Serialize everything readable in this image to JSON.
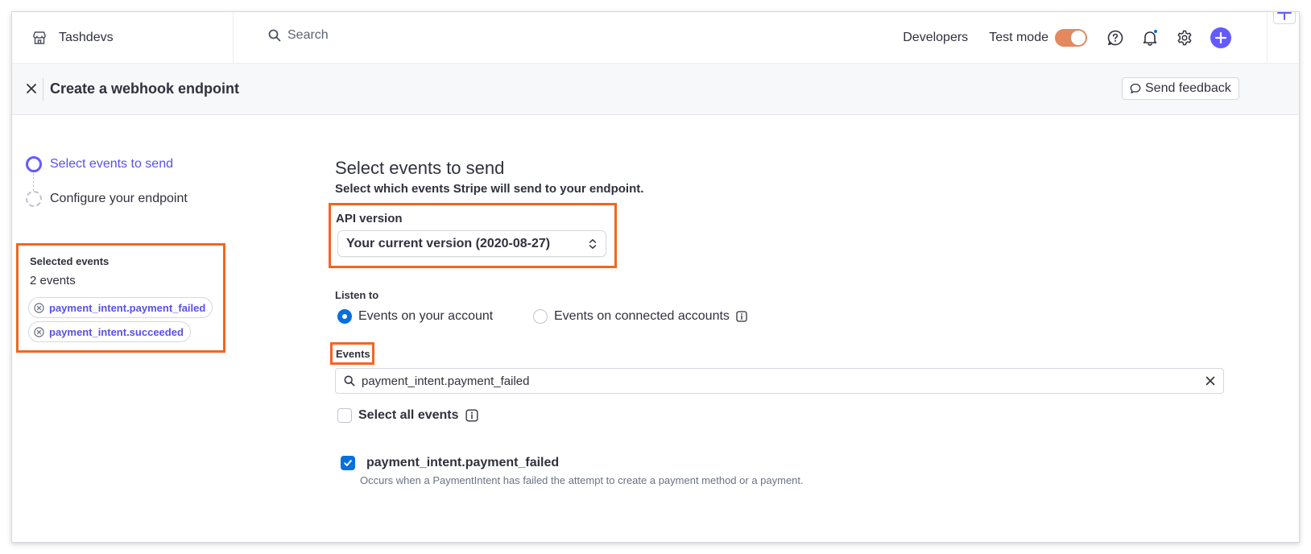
{
  "colors": {
    "accent": "#635bff",
    "link_accent": "#5851eb",
    "primary_blue": "#0570de",
    "test_mode_toggle": "#e3885f",
    "highlight_box": "#f26521"
  },
  "topbar": {
    "account_name": "Tashdevs",
    "account_icon": "store-icon",
    "search_placeholder": "Search",
    "developers_label": "Developers",
    "test_mode_label": "Test mode",
    "test_mode_on": true,
    "icons": [
      "help-icon",
      "bell-icon",
      "gear-icon",
      "plus-icon"
    ]
  },
  "subheader": {
    "title": "Create a webhook endpoint",
    "feedback_label": "Send feedback"
  },
  "stepper": {
    "steps": [
      {
        "label": "Select events to send",
        "state": "current"
      },
      {
        "label": "Configure your endpoint",
        "state": "pending"
      }
    ]
  },
  "selected_events": {
    "title": "Selected events",
    "count_label": "2 events",
    "items": [
      "payment_intent.payment_failed",
      "payment_intent.succeeded"
    ]
  },
  "form": {
    "title": "Select events to send",
    "subtitle": "Select which events Stripe will send to your endpoint.",
    "api_version_label": "API version",
    "api_version_value": "Your current version (2020-08-27)",
    "listen_label": "Listen to",
    "listen_options": [
      {
        "label": "Events on your account",
        "selected": true
      },
      {
        "label": "Events on connected accounts",
        "selected": false
      }
    ],
    "events_label": "Events",
    "events_search_value": "payment_intent.payment_failed",
    "select_all_label": "Select all events",
    "results": [
      {
        "name": "payment_intent.payment_failed",
        "description": "Occurs when a PaymentIntent has failed the attempt to create a payment method or a payment.",
        "checked": true
      }
    ]
  }
}
